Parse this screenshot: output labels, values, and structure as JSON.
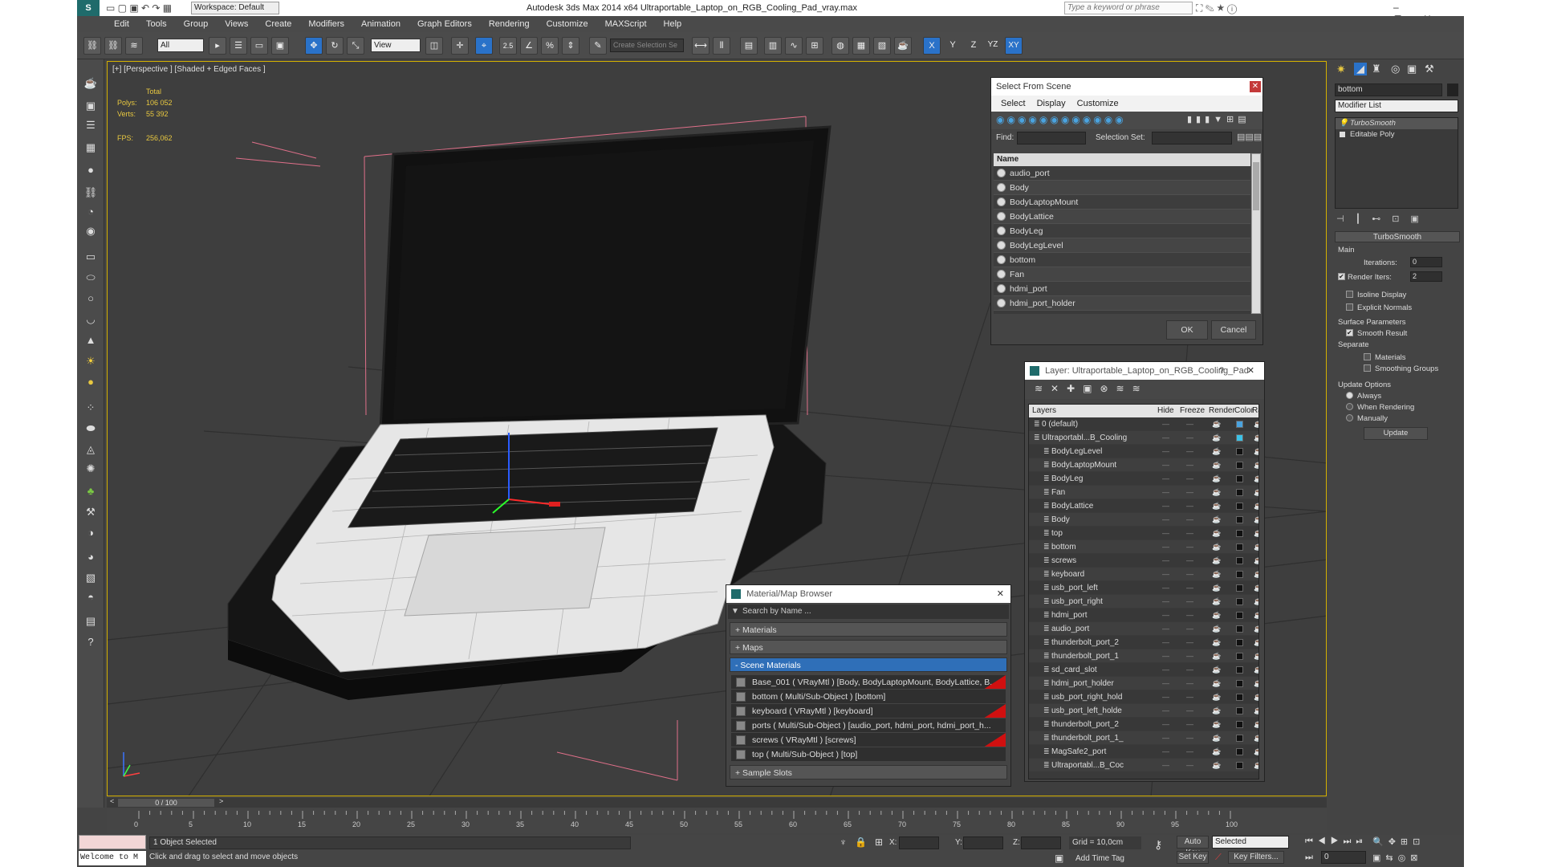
{
  "titlebar": {
    "workspace": "Workspace: Default",
    "title": "Autodesk 3ds Max  2014 x64     Ultraportable_Laptop_on_RGB_Cooling_Pad_vray.max",
    "search_placeholder": "Type a keyword or phrase"
  },
  "menu": [
    "Edit",
    "Tools",
    "Group",
    "Views",
    "Create",
    "Modifiers",
    "Animation",
    "Graph Editors",
    "Rendering",
    "Customize",
    "MAXScript",
    "Help"
  ],
  "toolbar": {
    "filter": "All",
    "refcoord": "View",
    "selection_set": "Create Selection Se",
    "axis_x": "X",
    "axis_y": "Y",
    "axis_z": "Z",
    "axis_yz": "YZ",
    "axis_xy": "XY",
    "snap": "2.5",
    "percent": "%"
  },
  "viewport": {
    "label": "[+] [Perspective ] [Shaded + Edged Faces ]",
    "total_label": "Total",
    "polys_label": "Polys:",
    "polys": "106 052",
    "verts_label": "Verts:",
    "verts": "55 392",
    "fps_label": "FPS:",
    "fps": "256,062"
  },
  "select_from_scene": {
    "title": "Select From Scene",
    "menu": [
      "Select",
      "Display",
      "Customize"
    ],
    "find_label": "Find:",
    "selset_label": "Selection Set:",
    "col_name": "Name",
    "items": [
      "audio_port",
      "Body",
      "BodyLaptopMount",
      "BodyLattice",
      "BodyLeg",
      "BodyLegLevel",
      "bottom",
      "Fan",
      "hdmi_port",
      "hdmi_port_holder"
    ],
    "ok": "OK",
    "cancel": "Cancel"
  },
  "layer_dialog": {
    "title": "Layer: Ultraportable_Laptop_on_RGB_Cooling_Pad",
    "help": "?",
    "cols": [
      "Layers",
      "Hide",
      "Freeze",
      "Render",
      "Color",
      "Radiosity"
    ],
    "rows": [
      {
        "name": "0 (default)",
        "color": "#4aa3df",
        "level": 0
      },
      {
        "name": "Ultraportabl...B_Cooling",
        "color": "#3cc2e6",
        "level": 0
      },
      {
        "name": "BodyLegLevel",
        "color": "#111111",
        "level": 1
      },
      {
        "name": "BodyLaptopMount",
        "color": "#111111",
        "level": 1
      },
      {
        "name": "BodyLeg",
        "color": "#111111",
        "level": 1
      },
      {
        "name": "Fan",
        "color": "#111111",
        "level": 1
      },
      {
        "name": "BodyLattice",
        "color": "#111111",
        "level": 1
      },
      {
        "name": "Body",
        "color": "#111111",
        "level": 1
      },
      {
        "name": "top",
        "color": "#111111",
        "level": 1
      },
      {
        "name": "bottom",
        "color": "#111111",
        "level": 1
      },
      {
        "name": "screws",
        "color": "#111111",
        "level": 1
      },
      {
        "name": "keyboard",
        "color": "#111111",
        "level": 1
      },
      {
        "name": "usb_port_left",
        "color": "#111111",
        "level": 1
      },
      {
        "name": "usb_port_right",
        "color": "#111111",
        "level": 1
      },
      {
        "name": "hdmi_port",
        "color": "#111111",
        "level": 1
      },
      {
        "name": "audio_port",
        "color": "#111111",
        "level": 1
      },
      {
        "name": "thunderbolt_port_2",
        "color": "#111111",
        "level": 1
      },
      {
        "name": "thunderbolt_port_1",
        "color": "#111111",
        "level": 1
      },
      {
        "name": "sd_card_slot",
        "color": "#111111",
        "level": 1
      },
      {
        "name": "hdmi_port_holder",
        "color": "#111111",
        "level": 1
      },
      {
        "name": "usb_port_right_hold",
        "color": "#111111",
        "level": 1
      },
      {
        "name": "usb_port_left_holde",
        "color": "#111111",
        "level": 1
      },
      {
        "name": "thunderbolt_port_2",
        "color": "#111111",
        "level": 1
      },
      {
        "name": "thunderbolt_port_1_",
        "color": "#111111",
        "level": 1
      },
      {
        "name": "MagSafe2_port",
        "color": "#111111",
        "level": 1
      },
      {
        "name": "Ultraportabl...B_Coc",
        "color": "#111111",
        "level": 1
      }
    ]
  },
  "material_browser": {
    "title": "Material/Map Browser",
    "search_placeholder": "Search by Name ...",
    "sec_materials": "+ Materials",
    "sec_maps": "+ Maps",
    "sec_scene": "- Scene Materials",
    "sec_sample": "+ Sample Slots",
    "items": [
      "Base_001  ( VRayMtl ) [Body, BodyLaptopMount, BodyLattice, B...",
      "bottom  ( Multi/Sub-Object ) [bottom]",
      "keyboard  ( VRayMtl ) [keyboard]",
      "ports  ( Multi/Sub-Object ) [audio_port, hdmi_port, hdmi_port_h...",
      "screws  ( VRayMtl ) [screws]",
      "top  ( Multi/Sub-Object ) [top]"
    ]
  },
  "command_panel": {
    "object_name": "bottom",
    "modifier_list": "Modifier List",
    "stack": [
      "TurboSmooth",
      "Editable Poly"
    ],
    "rollout_title": "TurboSmooth",
    "main_label": "Main",
    "iterations_label": "Iterations:",
    "iterations": "0",
    "render_iters_label": "Render Iters:",
    "render_iters": "2",
    "isoline": "Isoline Display",
    "explicit_normals": "Explicit Normals",
    "surface_params": "Surface Parameters",
    "smooth_result": "Smooth Result",
    "separate": "Separate",
    "materials": "Materials",
    "smoothing_groups": "Smoothing Groups",
    "update_options": "Update Options",
    "always": "Always",
    "when_rendering": "When Rendering",
    "manually": "Manually",
    "update_btn": "Update"
  },
  "timeline": {
    "frame": "0 / 100",
    "ticks": [
      "0",
      "5",
      "10",
      "15",
      "20",
      "25",
      "30",
      "35",
      "40",
      "45",
      "50",
      "55",
      "60",
      "65",
      "70",
      "75",
      "80",
      "85",
      "90",
      "95",
      "100"
    ]
  },
  "status": {
    "maxscript": "Welcome to M",
    "selected": "1 Object Selected",
    "prompt": "Click and drag to select and move objects",
    "x_label": "X:",
    "y_label": "Y:",
    "z_label": "Z:",
    "grid": "Grid = 10,0cm",
    "add_time_tag": "Add Time Tag",
    "auto_key": "Auto Key",
    "set_key": "Set Key",
    "selected_dd": "Selected",
    "key_filters": "Key Filters...",
    "frame_field": "0"
  }
}
